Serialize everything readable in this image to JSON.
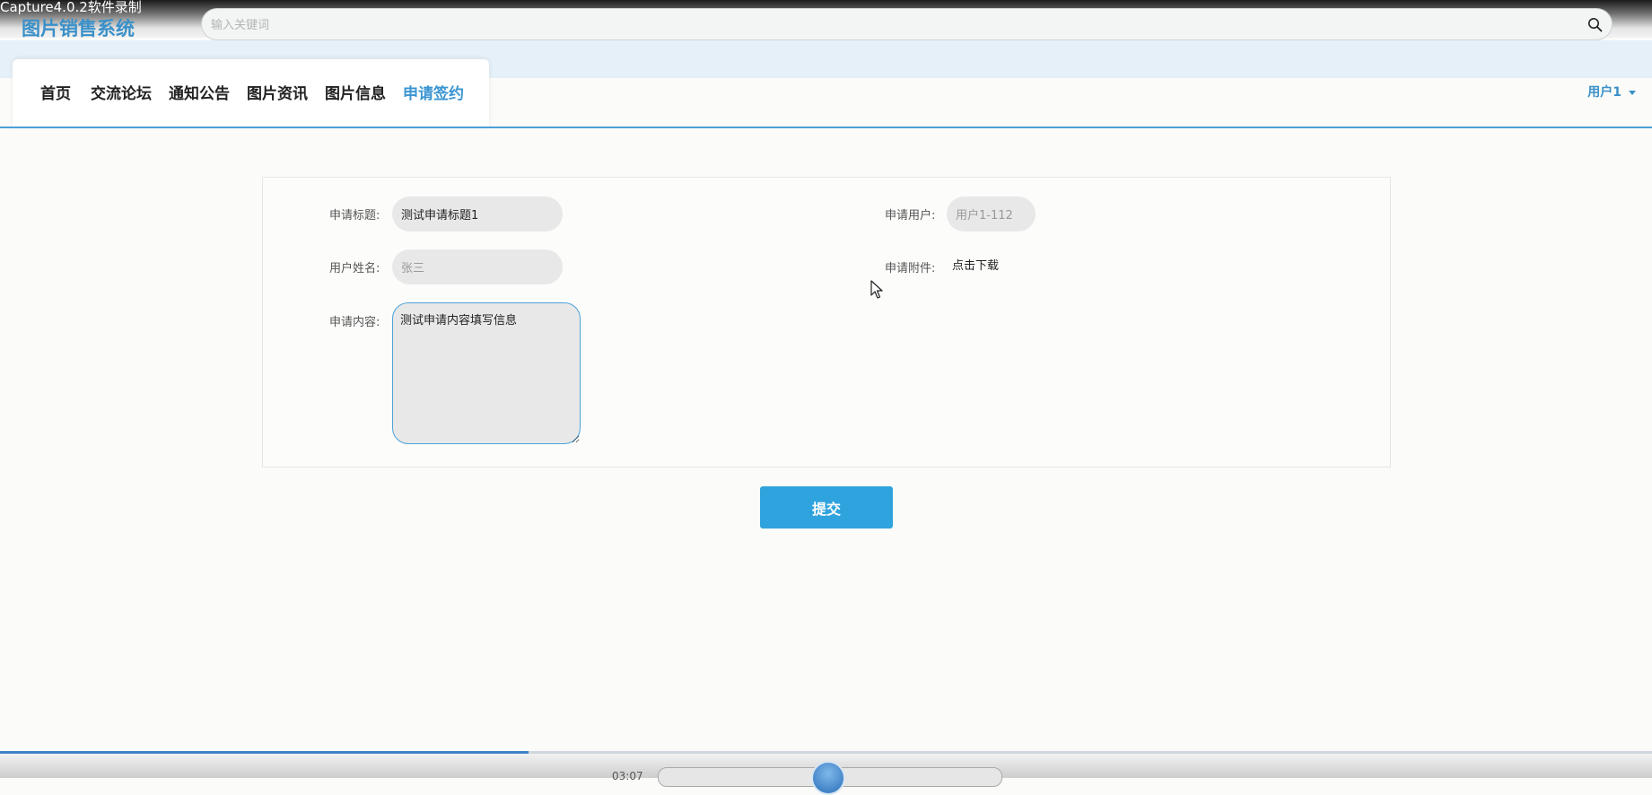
{
  "recorder": {
    "title": "Capture4.0.2软件录制"
  },
  "brand": {
    "name": "图片销售系统"
  },
  "search": {
    "placeholder": "输入关键词"
  },
  "nav": {
    "items": [
      {
        "label": "首页"
      },
      {
        "label": "交流论坛"
      },
      {
        "label": "通知公告"
      },
      {
        "label": "图片资讯"
      },
      {
        "label": "图片信息"
      },
      {
        "label": "申请签约"
      }
    ],
    "active_index": 5
  },
  "user_menu": {
    "label": "用户1"
  },
  "form": {
    "title_label": "申请标题:",
    "title_value": "测试申请标题1",
    "applicant_label": "申请用户:",
    "applicant_value": "用户1-112",
    "name_label": "用户姓名:",
    "name_value": "张三",
    "attachment_label": "申请附件:",
    "attachment_link": "点击下载",
    "content_label": "申请内容:",
    "content_value": "测试申请内容填写信息"
  },
  "submit": {
    "label": "提交"
  },
  "player": {
    "time": "03:07",
    "progress": 0.32
  },
  "colors": {
    "accent": "#3a90c9",
    "button": "#2fa3dd",
    "nav_active": "#3a95d2"
  }
}
